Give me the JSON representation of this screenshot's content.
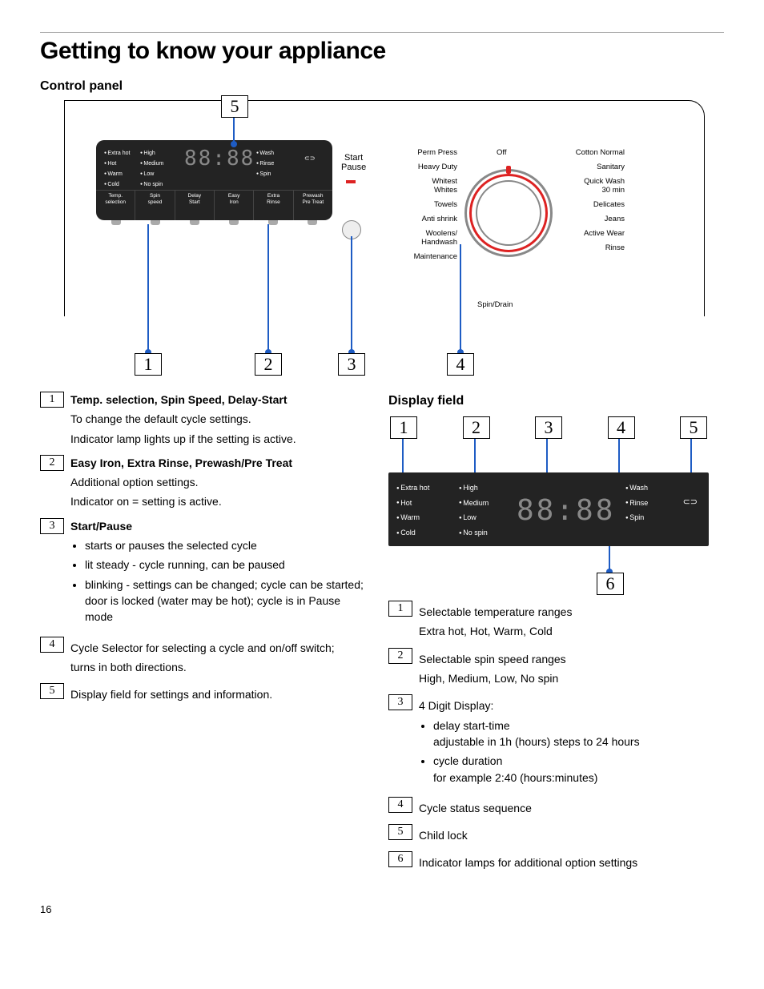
{
  "page": {
    "title": "Getting to know your appliance",
    "section_control": "Control panel",
    "section_display": "Display field",
    "page_number": "16"
  },
  "panel": {
    "temp": [
      "Extra hot",
      "Hot",
      "Warm",
      "Cold"
    ],
    "spin": [
      "High",
      "Medium",
      "Low",
      "No spin"
    ],
    "phase": [
      "Wash",
      "Rinse",
      "Spin"
    ],
    "digits": "88:88",
    "buttons": {
      "b1": "Temp.\nselection",
      "b2": "Spin\nspeed",
      "b3": "Delay\nStart",
      "b4": "Easy\nIron",
      "b5": "Extra\nRinse",
      "b6": "Prewash\nPre Treat"
    },
    "start": "Start",
    "pause": "Pause",
    "off": "Off",
    "spin_drain": "Spin/Drain",
    "prog_left": [
      "Perm Press",
      "Heavy Duty",
      "Whitest\nWhites",
      "Towels",
      "Anti shrink",
      "Woolens/\nHandwash",
      "Maintenance"
    ],
    "prog_right": [
      "Cotton Normal",
      "Sanitary",
      "Quick Wash\n30 min",
      "Delicates",
      "Jeans",
      "Active Wear",
      "Rinse"
    ]
  },
  "callouts": {
    "n1": "1",
    "n2": "2",
    "n3": "3",
    "n4": "4",
    "n5": "5",
    "n6": "6"
  },
  "legend_control": [
    {
      "num": "1",
      "title": "Temp. selection, Spin Speed, Delay-Start",
      "bold": true,
      "lines": [
        "To change the default cycle settings.",
        "Indicator lamp lights up if the setting is active."
      ]
    },
    {
      "num": "2",
      "title": "Easy Iron, Extra Rinse, Prewash/Pre Treat",
      "bold": true,
      "lines": [
        "Additional option settings.",
        "Indicator on = setting is active."
      ]
    },
    {
      "num": "3",
      "title": "Start/Pause",
      "bold": true,
      "bullets": [
        "starts or pauses the selected cycle",
        "lit steady - cycle running, can be paused",
        "blinking - settings can be changed; cycle can be started; door is locked (water may be hot); cycle is in Pause mode"
      ]
    },
    {
      "num": "4",
      "lines": [
        "Cycle Selector for selecting a cycle and on/off switch;",
        "turns in both directions."
      ]
    },
    {
      "num": "5",
      "lines": [
        "Display field for settings and information."
      ]
    }
  ],
  "legend_display": [
    {
      "num": "1",
      "lines": [
        "Selectable temperature ranges",
        "Extra hot, Hot, Warm, Cold"
      ]
    },
    {
      "num": "2",
      "lines": [
        "Selectable spin speed ranges",
        "High, Medium, Low, No spin"
      ]
    },
    {
      "num": "3",
      "lines": [
        "4 Digit Display:"
      ],
      "bullets": [
        "delay start-time\nadjustable in 1h (hours) steps to 24 hours",
        "cycle duration\nfor example 2:40 (hours:minutes)"
      ]
    },
    {
      "num": "4",
      "lines": [
        "Cycle status sequence"
      ]
    },
    {
      "num": "5",
      "lines": [
        "Child lock"
      ]
    },
    {
      "num": "6",
      "lines": [
        "Indicator lamps for additional option settings"
      ]
    }
  ]
}
